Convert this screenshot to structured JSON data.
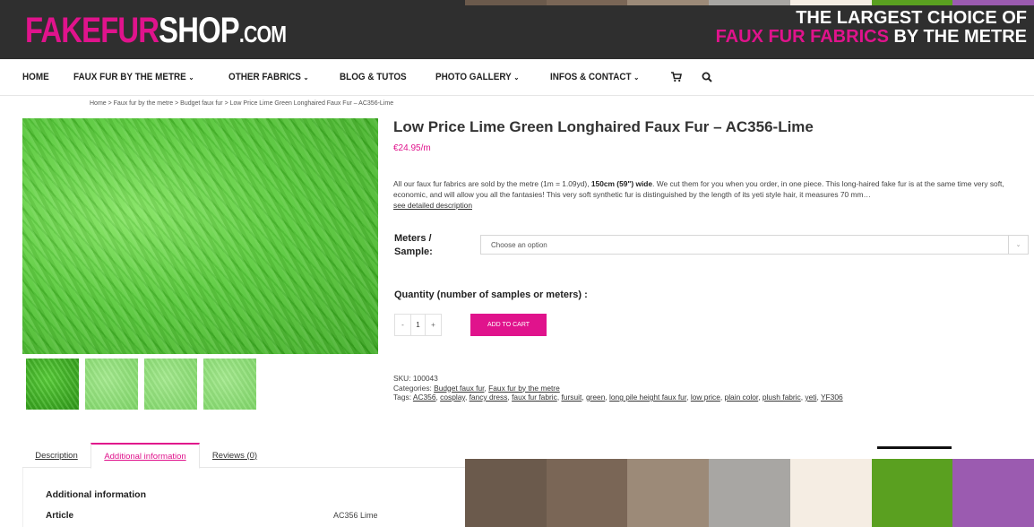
{
  "header": {
    "logo": {
      "part1": "FAKE",
      "part2": "FUR",
      "part3": "SHOP",
      "part4": ".COM"
    },
    "tagline_line1": "THE LARGEST CHOICE OF",
    "tagline_pink": "FAUX FUR FABRICS",
    "tagline_white": " BY THE METRE",
    "top_swatches": [
      "#6b5a4c",
      "#7a6656",
      "#9c8a78",
      "#a8a6a3",
      "#f5ede3",
      "#5aa020",
      "#9b5bb0"
    ]
  },
  "nav": {
    "items": [
      {
        "label": "HOME",
        "dropdown": false
      },
      {
        "label": "FAUX FUR BY THE METRE",
        "dropdown": true
      },
      {
        "label": "OTHER FABRICS",
        "dropdown": true
      },
      {
        "label": "BLOG & TUTOS",
        "dropdown": false
      },
      {
        "label": "PHOTO GALLERY",
        "dropdown": true
      },
      {
        "label": "INFOS & CONTACT",
        "dropdown": true
      }
    ],
    "chevron": "⌄",
    "icons": [
      "cart-icon",
      "search-icon"
    ]
  },
  "breadcrumb": "Home > Faux fur by the metre > Budget faux fur > Low Price Lime Green Longhaired Faux Fur – AC356-Lime",
  "product": {
    "title": "Low Price Lime Green Longhaired Faux Fur – AC356-Lime",
    "price": "€24.95/m",
    "desc_part1": "All our faux fur fabrics are sold by the metre (1m = 1.09yd), ",
    "desc_bold": "150cm (59\") wide",
    "desc_part2": ". We cut them for you when you order, in one piece. This long-haired fake fur is at the same time very soft, economic, and will allow you all the fantasies! This very soft synthetic fur is distinguished by the length of its yeti style hair, it measures 70 mm…",
    "desc_link": "see detailed description",
    "option_label": "Meters / Sample:",
    "select_placeholder": "Choose an option",
    "quantity_label": "Quantity (number of samples or meters) :",
    "qty_minus": "-",
    "qty_value": "1",
    "qty_plus": "+",
    "add_to_cart": "ADD TO CART",
    "sku_label": "SKU: ",
    "sku": "100043",
    "categories_label": "Categories: ",
    "categories": [
      "Budget faux fur",
      "Faux fur by the metre"
    ],
    "tags_label": "Tags: ",
    "tags": [
      "AC356",
      "cosplay",
      "fancy dress",
      "faux fur fabric",
      "fursuit",
      "green",
      "long pile height faux fur",
      "low price",
      "plain color",
      "plush fabric",
      "yeti",
      "YF306"
    ],
    "image_color": "#52c833"
  },
  "tabs": {
    "items": [
      "Description",
      "Additional information",
      "Reviews (0)"
    ],
    "active_index": 1
  },
  "additional_info": {
    "title": "Additional information",
    "rows": [
      {
        "label": "Article",
        "value": "AC356 Lime"
      }
    ]
  },
  "swatches": [
    "#6b5a4c",
    "#7a6656",
    "#9c8a78",
    "#a8a6a3",
    "#f5ede3",
    "#5aa020",
    "#9b5bb0"
  ],
  "colors": {
    "accent": "#e0138c",
    "header_bg": "#2f2f2f"
  }
}
